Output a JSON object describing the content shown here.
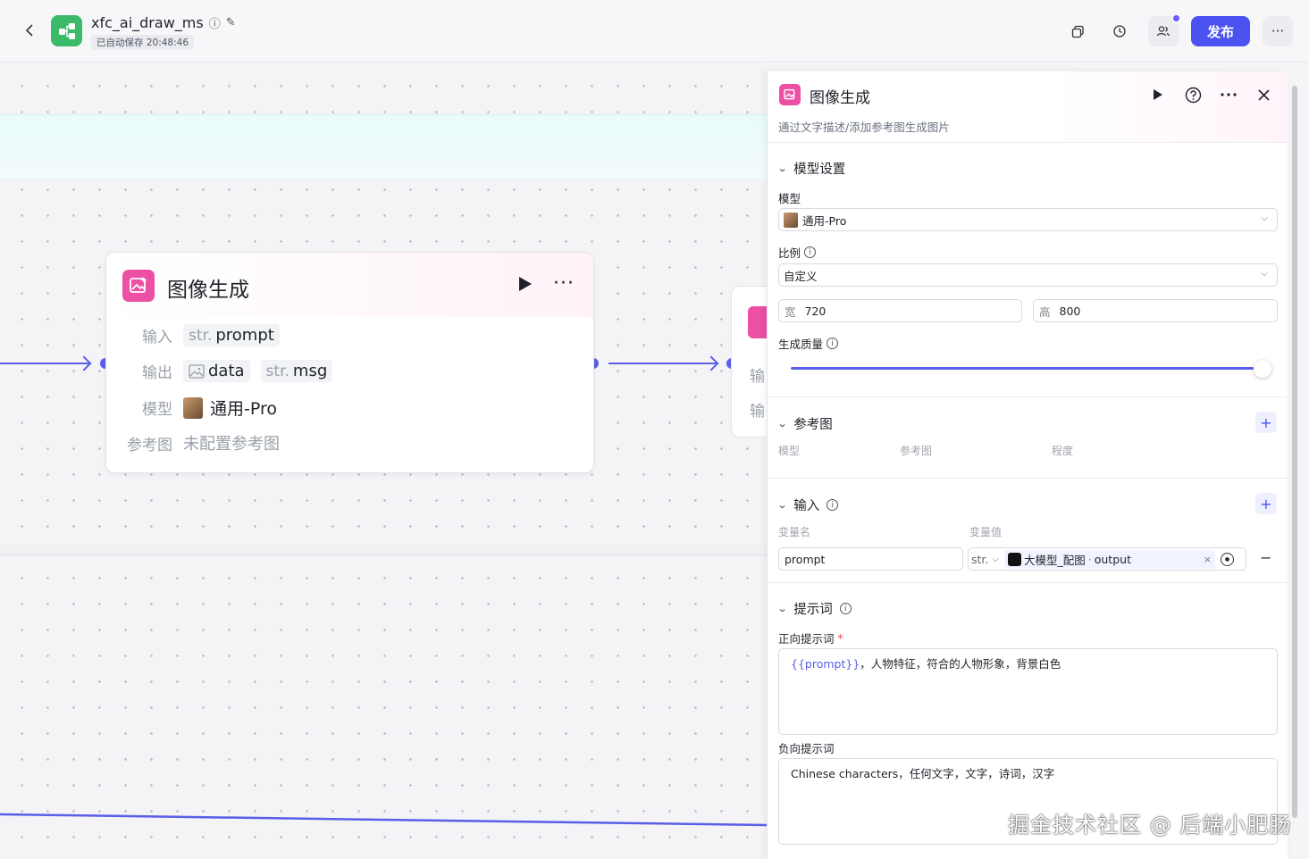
{
  "header": {
    "title": "xfc_ai_draw_ms",
    "autosave": "已自动保存 20:48:46",
    "publish_label": "发布",
    "more_label": "···"
  },
  "node": {
    "title": "图像生成",
    "more": "···",
    "input_label": "输入",
    "input_type": "str.",
    "input_name": "prompt",
    "output_label": "输出",
    "output1_name": "data",
    "output2_type": "str.",
    "output2_name": "msg",
    "model_label": "模型",
    "model_value": "通用-Pro",
    "ref_label": "参考图",
    "ref_value": "未配置参考图"
  },
  "node2": {
    "label1": "输",
    "label2": "输"
  },
  "panel": {
    "title": "图像生成",
    "subtitle": "通过文字描述/添加参考图生成图片",
    "model_section": "模型设置",
    "model_label": "模型",
    "model_value": "通用-Pro",
    "ratio_label": "比例",
    "ratio_value": "自定义",
    "width_prefix": "宽",
    "width_value": "720",
    "height_prefix": "高",
    "height_value": "800",
    "quality_label": "生成质量",
    "quality_level": 1.0,
    "ref_section": "参考图",
    "ref_cols": [
      "模型",
      "参考图",
      "程度"
    ],
    "input_section": "输入",
    "var_name_label": "变量名",
    "var_value_label": "变量值",
    "var_name": "prompt",
    "var_type": "str.",
    "var_ref": "大模型_配图",
    "var_ref_field": "output",
    "prompt_section": "提示词",
    "positive_label": "正向提示词",
    "positive_var": "{{prompt}}",
    "positive_text": "，人物特征，符合的人物形象，背景白色",
    "negative_label": "负向提示词",
    "negative_text": "Chinese characters，任何文字，文字，诗词，汉字"
  },
  "watermark": "掘金技术社区 @ 后端小肥肠",
  "colors": {
    "accent": "#4b52f0",
    "edge": "#5a5ee8",
    "node_icon": "#ec4fa3",
    "app_icon": "#3bba6a"
  }
}
